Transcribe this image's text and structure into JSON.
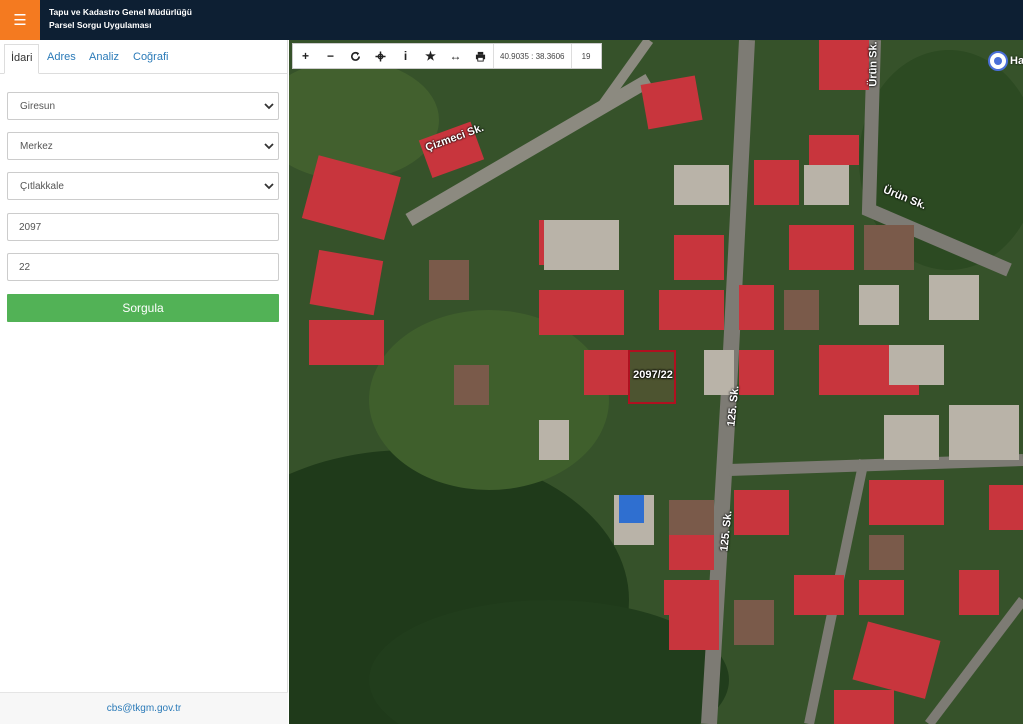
{
  "header": {
    "menu_icon": "hamburger-icon",
    "title_line1": "Tapu ve Kadastro Genel Müdürlüğü",
    "title_line2": "Parsel Sorgu Uygulaması",
    "bar_color": "#0d1f33",
    "menu_color": "#f47a20"
  },
  "tabs": [
    {
      "label": "İdari",
      "active": true
    },
    {
      "label": "Adres"
    },
    {
      "label": "Analiz"
    },
    {
      "label": "Coğrafi"
    }
  ],
  "form": {
    "province": "Giresun",
    "district": "Merkez",
    "neighborhood": "Çıtlakkale",
    "block": "2097",
    "parcel": "22",
    "submit": "Sorgula",
    "submit_color": "#52b256"
  },
  "footer": {
    "email": "cbs@tkgm.gov.tr"
  },
  "map_toolbar": {
    "tools": [
      "zoom-in-icon",
      "zoom-out-icon",
      "refresh-icon",
      "pan-icon",
      "info-icon",
      "favorite-icon",
      "measure-icon",
      "print-icon"
    ],
    "coordinates": "40.9035 : 38.3606",
    "zoom_level": "19"
  },
  "map": {
    "streets": [
      "Çizmeci Sk.",
      "Ürün Sk.",
      "Ürün Sk.",
      "125. Sk.",
      "125. Sk."
    ],
    "parcel_label": "2097/22",
    "poi_label": "Ha"
  }
}
